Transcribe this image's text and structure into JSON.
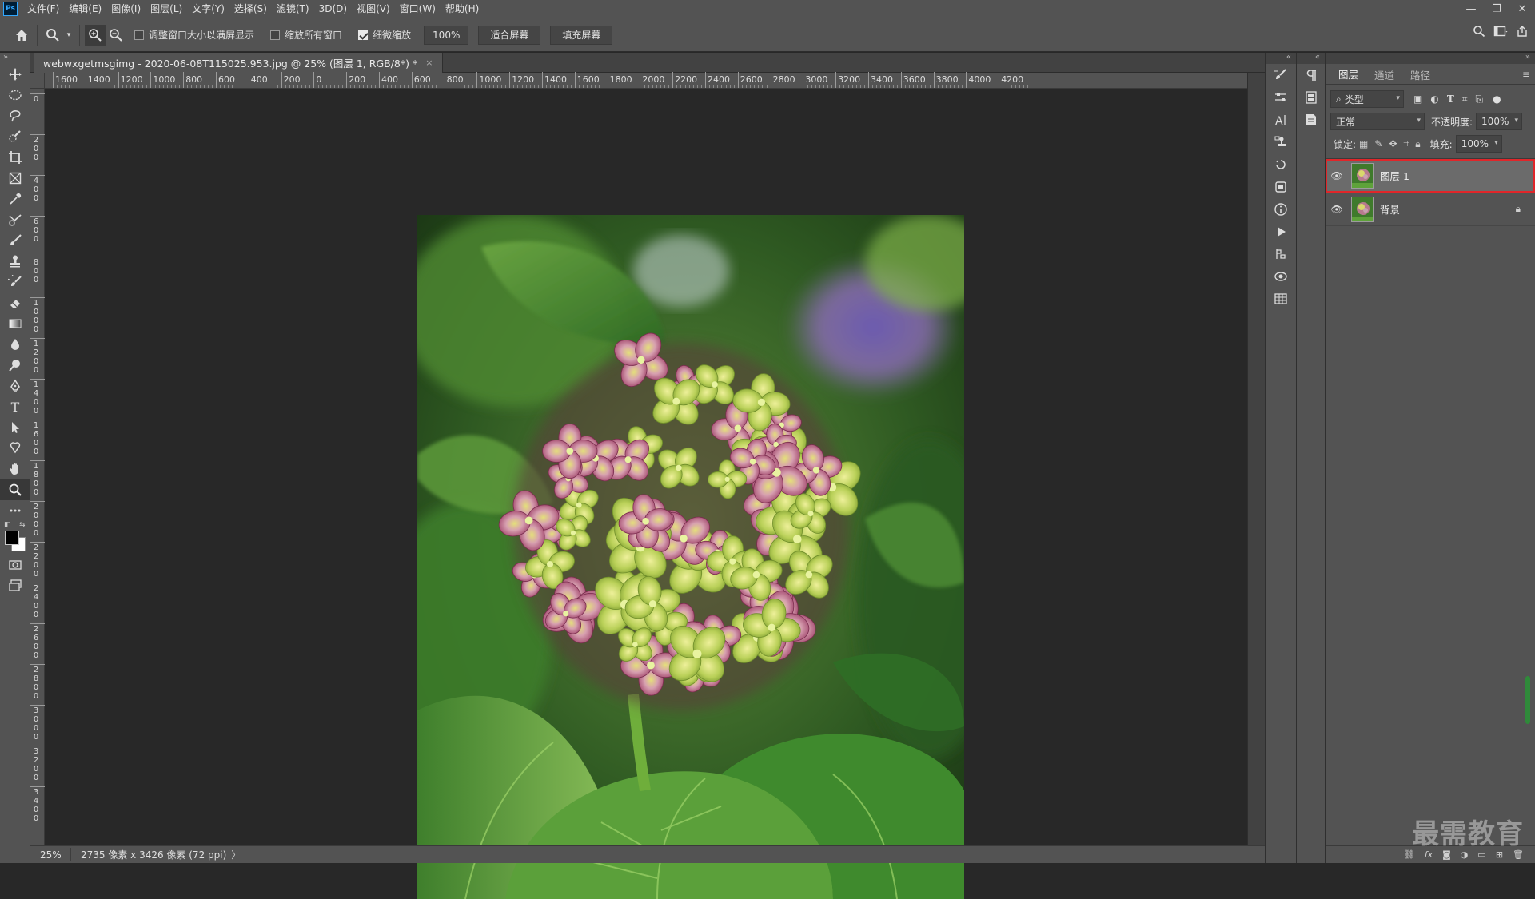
{
  "app": {
    "logo": "Ps"
  },
  "menu": [
    "文件(F)",
    "编辑(E)",
    "图像(I)",
    "图层(L)",
    "文字(Y)",
    "选择(S)",
    "滤镜(T)",
    "3D(D)",
    "视图(V)",
    "窗口(W)",
    "帮助(H)"
  ],
  "window_controls": {
    "minimize": "—",
    "restore": "❐",
    "close": "✕"
  },
  "options": {
    "resize_window_label": "调整窗口大小以满屏显示",
    "resize_window_checked": false,
    "zoom_all_label": "缩放所有窗口",
    "zoom_all_checked": false,
    "scrubby_zoom_label": "细微缩放",
    "scrubby_zoom_checked": true,
    "zoom_value": "100%",
    "fit_screen_label": "适合屏幕",
    "fill_screen_label": "填充屏幕"
  },
  "document": {
    "tab_title": "webwxgetmsgimg - 2020-06-08T115025.953.jpg @ 25% (图层 1, RGB/8*) *",
    "tab_close": "×"
  },
  "rulers": {
    "horizontal": [
      "1600",
      "1400",
      "1200",
      "1000",
      "800",
      "600",
      "400",
      "200",
      "0",
      "200",
      "400",
      "600",
      "800",
      "1000",
      "1200",
      "1400",
      "1600",
      "1800",
      "2000",
      "2200",
      "2400",
      "2600",
      "2800",
      "3000",
      "3200",
      "3400",
      "3600",
      "3800",
      "4000",
      "4200"
    ],
    "vertical": [
      "0",
      "2 0 0",
      "4 0 0",
      "6 0 0",
      "8 0 0",
      "1 0 0 0",
      "1 2 0 0",
      "1 4 0 0",
      "1 6 0 0",
      "1 8 0 0",
      "2 0 0 0",
      "2 2 0 0",
      "2 4 0 0",
      "2 6 0 0",
      "2 8 0 0",
      "3 0 0 0",
      "3 2 0 0",
      "3 4 0 0"
    ]
  },
  "status": {
    "zoom": "25%",
    "info": "2735 像素 x 3426 像素 (72 ppi)",
    "arrow": "〉"
  },
  "panel": {
    "tabs": [
      "图层",
      "通道",
      "路径"
    ],
    "active_tab": "图层",
    "filter_kind": "类型",
    "blend_mode": "正常",
    "opacity_label": "不透明度:",
    "opacity_value": "100%",
    "lock_label": "锁定:",
    "fill_label": "填充:",
    "fill_value": "100%",
    "layers": [
      {
        "name": "图层 1",
        "visible": true,
        "selected": true,
        "locked": false
      },
      {
        "name": "背景",
        "visible": true,
        "selected": false,
        "locked": true
      }
    ],
    "footer_icons": [
      "link-icon",
      "fx-icon",
      "mask-icon",
      "adjustment-icon",
      "folder-icon",
      "new-layer-icon",
      "trash-icon"
    ],
    "fx_label": "fx"
  },
  "watermark": "最需教育",
  "colors": {
    "ui_bg": "#535353",
    "canvas_bg": "#282828",
    "selection_outline": "#e0262a",
    "selected_layer_bg": "#6b6b6b"
  }
}
